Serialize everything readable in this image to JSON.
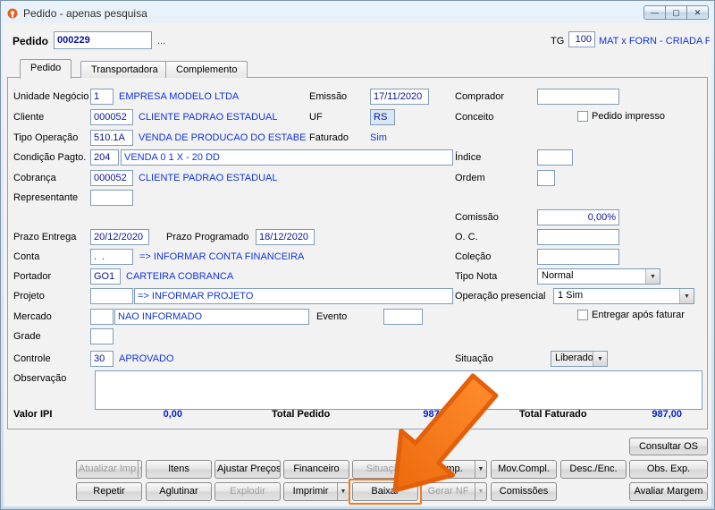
{
  "window": {
    "title": "Pedido - apenas pesquisa",
    "controls": {
      "minimize": "—",
      "maximize": "▢",
      "close": "✕"
    }
  },
  "header": {
    "pedido_label": "Pedido",
    "pedido_value": "000229",
    "lookup": "...",
    "tg_label": "TG",
    "tg_value": "100",
    "tg_desc": "MAT x FORN - CRIADA PE"
  },
  "tabs": [
    {
      "label": "Pedido"
    },
    {
      "label": "Transportadora"
    },
    {
      "label": "Complemento"
    }
  ],
  "fields": {
    "unidade_negocio": {
      "label": "Unidade Negócio",
      "value": "1",
      "desc": "EMPRESA MODELO LTDA"
    },
    "cliente": {
      "label": "Cliente",
      "value": "000052",
      "desc": "CLIENTE PADRAO ESTADUAL"
    },
    "tipo_operacao": {
      "label": "Tipo Operação",
      "value": "510.1A",
      "desc": "VENDA DE PRODUCAO DO ESTABELECIMEI"
    },
    "condicao_pagto": {
      "label": "Condição Pagto.",
      "value": "204",
      "desc": "VENDA 0 1 X - 20 DD"
    },
    "cobranca": {
      "label": "Cobrança",
      "value": "000052",
      "desc": "CLIENTE PADRAO ESTADUAL"
    },
    "representante": {
      "label": "Representante",
      "value": ""
    },
    "prazo_entrega": {
      "label": "Prazo Entrega",
      "value": "20/12/2020"
    },
    "prazo_programado": {
      "label": "Prazo Programado",
      "value": "18/12/2020"
    },
    "conta": {
      "label": "Conta",
      "value": ".  .",
      "desc": "=> INFORMAR CONTA FINANCEIRA"
    },
    "portador": {
      "label": "Portador",
      "value": "GO1",
      "desc": "CARTEIRA COBRANCA"
    },
    "projeto": {
      "label": "Projeto",
      "value": "",
      "desc": "=> INFORMAR PROJETO"
    },
    "mercado": {
      "label": "Mercado",
      "value": "",
      "desc": "NAO INFORMADO"
    },
    "evento": {
      "label": "Evento",
      "value": ""
    },
    "grade": {
      "label": "Grade",
      "value": ""
    },
    "controle": {
      "label": "Controle",
      "value": "30",
      "desc": "APROVADO"
    },
    "observacao": {
      "label": "Observação",
      "value": ""
    },
    "emissao": {
      "label": "Emissão",
      "value": "17/11/2020"
    },
    "uf": {
      "label": "UF",
      "value": "RS"
    },
    "faturado": {
      "label": "Faturado",
      "value": "Sim"
    },
    "comprador": {
      "label": "Comprador",
      "value": ""
    },
    "conceito": {
      "label": "Conceito"
    },
    "pedido_impresso": {
      "label": "Pedido impresso",
      "checked": false
    },
    "indice": {
      "label": "Índice",
      "value": ""
    },
    "ordem": {
      "label": "Ordem",
      "value": ""
    },
    "comissao": {
      "label": "Comissão",
      "value": "0,00%"
    },
    "oc": {
      "label": "O. C.",
      "value": ""
    },
    "colecao": {
      "label": "Coleção",
      "value": ""
    },
    "tipo_nota": {
      "label": "Tipo Nota",
      "value": "Normal"
    },
    "operacao_presencial": {
      "label": "Operação presencial",
      "value": "1 Sim"
    },
    "entregar_apos_faturar": {
      "label": "Entregar após faturar",
      "checked": false
    },
    "situacao": {
      "label": "Situação",
      "value": "Liberado"
    }
  },
  "totals": {
    "valor_ipi": {
      "label": "Valor IPI",
      "value": "0,00"
    },
    "total_pedido": {
      "label": "Total Pedido",
      "value": "987,00"
    },
    "total_faturado": {
      "label": "Total Faturado",
      "value": "987,00"
    }
  },
  "buttons": {
    "consultar_os": "Consultar OS",
    "row1": [
      {
        "label": "Atualizar Imp",
        "disabled": true,
        "split": true
      },
      {
        "label": "Itens"
      },
      {
        "label": "Ajustar Preços"
      },
      {
        "label": "Financeiro"
      },
      {
        "label": "Situação",
        "disabled": true
      },
      {
        "label": "Comp.",
        "split": true
      },
      {
        "label": "Mov.Compl."
      },
      {
        "label": "Desc./Enc."
      },
      {
        "label": "Obs. Exp."
      }
    ],
    "row2": [
      {
        "label": "Repetir"
      },
      {
        "label": "Aglutinar"
      },
      {
        "label": "Explodir",
        "disabled": true
      },
      {
        "label": "Imprimir",
        "split": true
      },
      {
        "label": "Baixar",
        "highlight": true
      },
      {
        "label": "Gerar NF",
        "disabled": true,
        "split": true
      },
      {
        "label": "Comissões"
      },
      {
        "label": "Avaliar Margem"
      }
    ]
  },
  "colors": {
    "accent_orange": "#f0751d",
    "value_text": "#0b1398",
    "link_text": "#1134e0"
  }
}
